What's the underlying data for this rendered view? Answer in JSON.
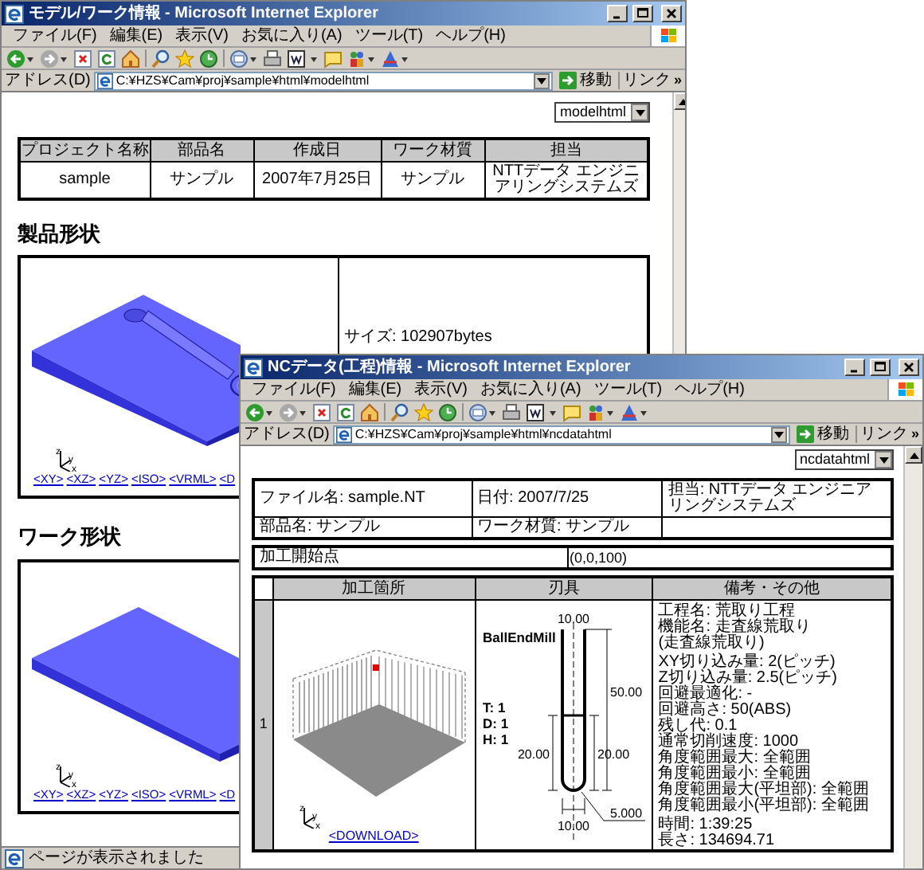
{
  "model_window": {
    "title": "モデル/ワーク情報 - Microsoft Internet Explorer",
    "menu": [
      "ファイル(F)",
      "編集(E)",
      "表示(V)",
      "お気に入り(A)",
      "ツール(T)",
      "ヘルプ(H)"
    ],
    "address_label": "アドレス(D)",
    "address": "C:¥HZS¥Cam¥proj¥sample¥html¥modelhtml",
    "go": "移動",
    "links": "リンク",
    "more_links": "»",
    "page_select": "modelhtml",
    "info_table": {
      "columns": [
        "プロジェクト名称",
        "部品名",
        "作成日",
        "ワーク材質",
        "担当"
      ],
      "row": [
        "sample",
        "サンプル",
        "2007年7月25日",
        "サンプル",
        "NTTデータ エンジニアリングシステムズ"
      ]
    },
    "sections": [
      {
        "heading": "製品形状",
        "kind": "product",
        "axis_labels": [
          "z",
          "y",
          "x"
        ],
        "links": [
          "<XY>",
          "<XZ>",
          "<YZ>",
          "<ISO>",
          "<VRML>",
          "<D"
        ],
        "size": "サイズ: 102907bytes"
      },
      {
        "heading": "ワーク形状",
        "kind": "work",
        "axis_labels": [
          "z",
          "y",
          "x"
        ],
        "links": [
          "<XY>",
          "<XZ>",
          "<YZ>",
          "<ISO>",
          "<VRML>",
          "<D"
        ]
      }
    ],
    "status": "ページが表示されました"
  },
  "nc_window": {
    "title": "NCデータ(工程)情報 - Microsoft Internet Explorer",
    "menu": [
      "ファイル(F)",
      "編集(E)",
      "表示(V)",
      "お気に入り(A)",
      "ツール(T)",
      "ヘルプ(H)"
    ],
    "address_label": "アドレス(D)",
    "address": "C:¥HZS¥Cam¥proj¥sample¥html¥ncdatahtml",
    "go": "移動",
    "links": "リンク",
    "more_links": "»",
    "page_select": "ncdatahtml",
    "info_rows": [
      [
        "ファイル名: sample.NT",
        "日付: 2007/7/25",
        "担当: NTTデータ エンジニアリングシステムズ"
      ],
      [
        "部品名: サンプル",
        "ワーク材質: サンプル"
      ]
    ],
    "start_point": {
      "label": "加工開始点",
      "value": "(0,0,100)"
    },
    "process_table": {
      "columns": [
        "加工箇所",
        "刃具",
        "備考・その他"
      ],
      "rows": [
        {
          "index": "1",
          "axis_labels": [
            "z",
            "y",
            "x"
          ],
          "download": "<DOWNLOAD>",
          "tool": {
            "name": "BallEndMill",
            "params": [
              "T: 1",
              "D: 1",
              "H: 1"
            ],
            "dims": [
              "10.00",
              "50.00",
              "20.00",
              "20.00",
              "5.000",
              "10.00"
            ]
          },
          "notes": [
            [
              "工程名: 荒取り工程",
              "機能名: 走査線荒取り",
              "(走査線荒取り)"
            ],
            [
              "XY切り込み量: 2(ピッチ)",
              "Z切り込み量: 2.5(ピッチ)",
              "回避最適化: -",
              "回避高さ: 50(ABS)",
              "残し代: 0.1",
              "通常切削速度: 1000",
              "角度範囲最大: 全範囲",
              "角度範囲最小: 全範囲",
              "角度範囲最大(平坦部): 全範囲",
              "角度範囲最小(平坦部): 全範囲"
            ],
            [
              "時間: 1:39:25",
              "長さ: 134694.71"
            ]
          ]
        }
      ]
    }
  }
}
